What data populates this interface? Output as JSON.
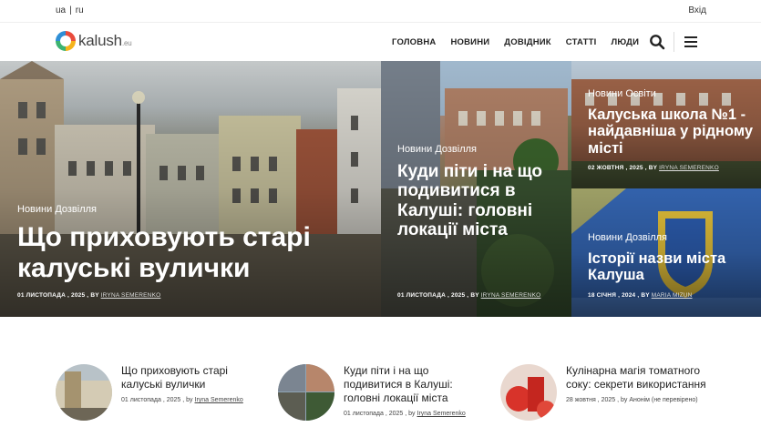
{
  "topbar": {
    "lang_ua": "ua",
    "lang_sep": "|",
    "lang_ru": "ru",
    "login": "Вхід"
  },
  "logo": {
    "name": "kalush",
    "tld": ".eu"
  },
  "nav": [
    "ГОЛОВНА",
    "НОВИНИ",
    "ДОВІДНИК",
    "СТАТТІ",
    "ЛЮДИ"
  ],
  "hero": {
    "big": {
      "category": "Новини Дозвілля",
      "title": "Що приховують старі калуські вулички",
      "date": "01 ЛИСТОПАДА , 2025",
      "by": "BY",
      "author": "IRYNA SEMERENKO"
    },
    "mid": {
      "category": "Новини Дозвілля",
      "title": "Куди піти і на що подивитися в Калуші: головні локації міста",
      "date": "01 ЛИСТОПАДА , 2025",
      "by": "BY",
      "author": "IRYNA SEMERENKO"
    },
    "top_right": {
      "category": "Новини Освіти",
      "title": "Калуська школа №1 - найдавніша у рідному місті",
      "date": "02 ЖОВТНЯ , 2025",
      "by": "BY",
      "author": "IRYNA SEMERENKO"
    },
    "bottom_right": {
      "category": "Новини Дозвілля",
      "title": "Історії назви міста Калуша",
      "date": "18 СІЧНЯ , 2024",
      "by": "BY",
      "author": "MARIA MIZUN"
    }
  },
  "list": [
    {
      "title": "Що приховують старі калуські вулички",
      "date": "01 листопада , 2025 , by",
      "author": "Iryna Semerenko"
    },
    {
      "title": "Куди піти і на що подивитися в Калуші: головні локації міста",
      "date": "01 листопада , 2025 , by",
      "author": "Iryna Semerenko"
    },
    {
      "title": "Кулінарна магія томатного соку: секрети використання",
      "date": "28 жовтня , 2025 , by Анонім (не перевірено)",
      "author": ""
    }
  ]
}
